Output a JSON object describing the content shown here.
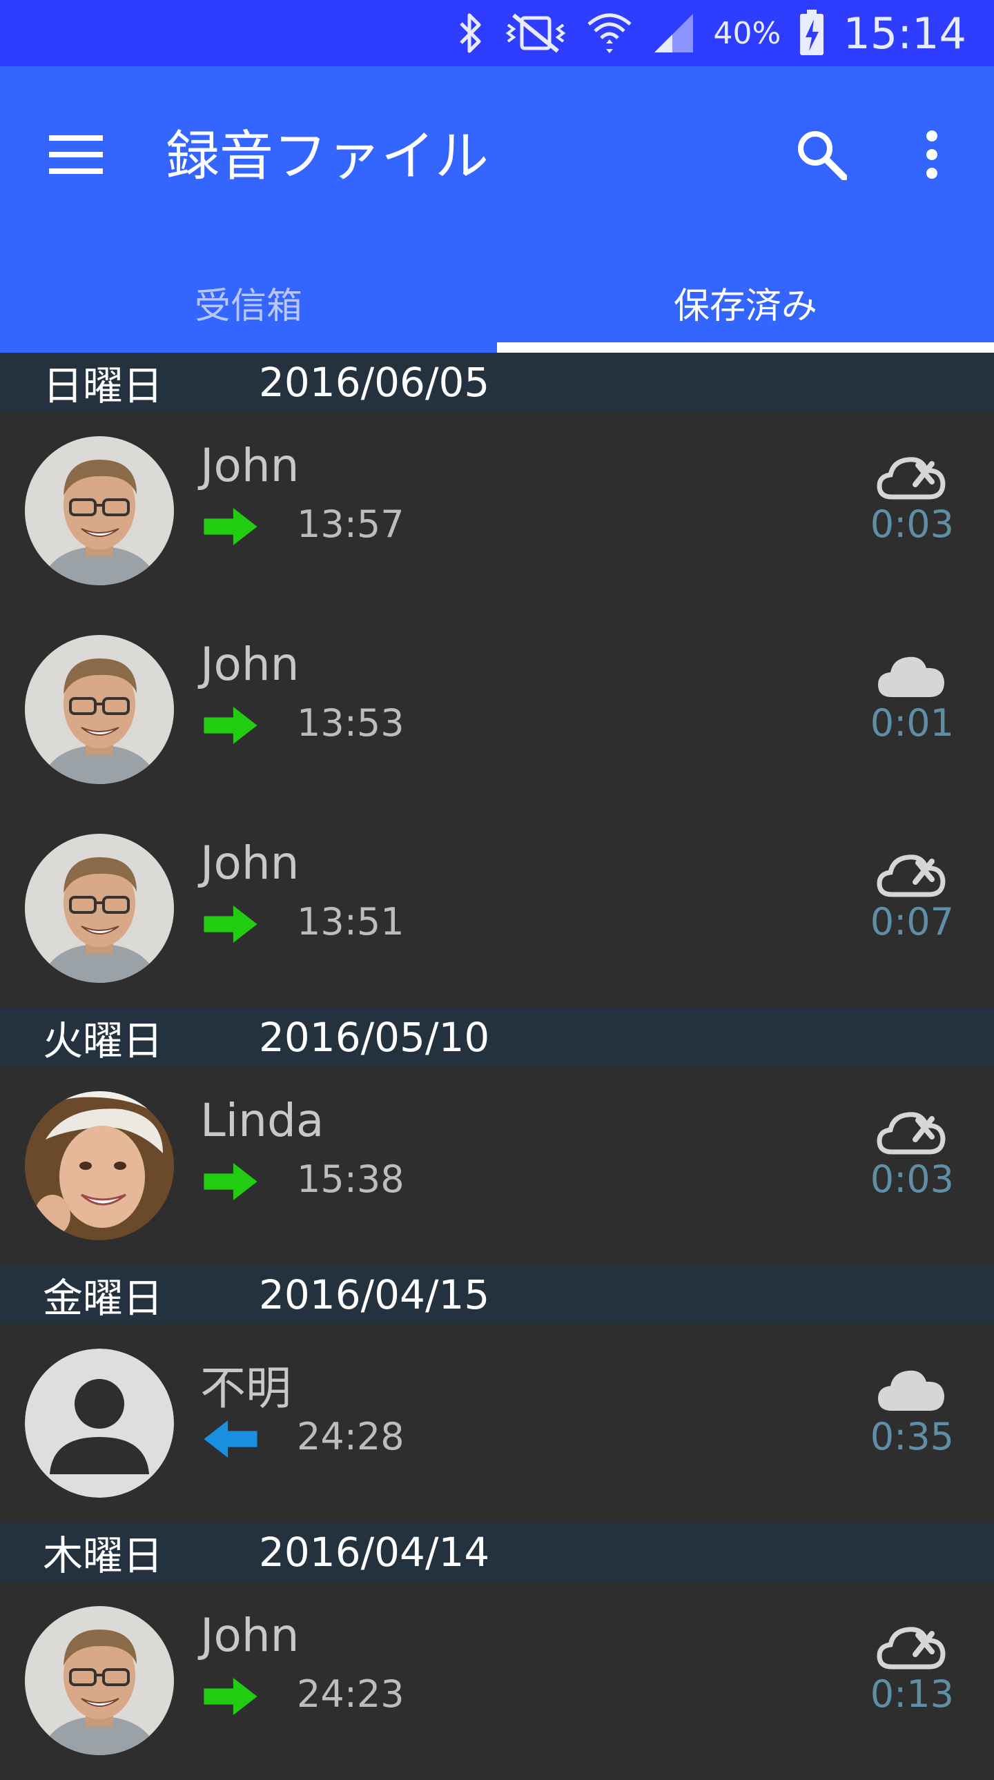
{
  "status_bar": {
    "battery_percent": "40%",
    "time": "15:14",
    "icons": [
      "bluetooth-icon",
      "vibrate-mute-icon",
      "wifi-icon",
      "signal-icon",
      "battery-charging-icon"
    ]
  },
  "app_bar": {
    "title": "録音ファイル",
    "menu_icon": "hamburger-menu-icon",
    "search_icon": "search-icon",
    "more_icon": "more-vert-icon"
  },
  "tabs": [
    {
      "label": "受信箱",
      "selected": false
    },
    {
      "label": "保存済み",
      "selected": true
    }
  ],
  "groups": [
    {
      "day": "日曜日",
      "date": "2016/06/05",
      "items": [
        {
          "name": "John",
          "direction": "outgoing",
          "time": "13:57",
          "duration": "0:03",
          "cloud": "cloud-off-icon"
        },
        {
          "name": "John",
          "direction": "outgoing",
          "time": "13:53",
          "duration": "0:01",
          "cloud": "cloud-icon"
        },
        {
          "name": "John",
          "direction": "outgoing",
          "time": "13:51",
          "duration": "0:07",
          "cloud": "cloud-off-icon"
        }
      ]
    },
    {
      "day": "火曜日",
      "date": "2016/05/10",
      "items": [
        {
          "name": "Linda",
          "direction": "outgoing",
          "time": "15:38",
          "duration": "0:03",
          "cloud": "cloud-off-icon"
        }
      ]
    },
    {
      "day": "金曜日",
      "date": "2016/04/15",
      "items": [
        {
          "name": "不明",
          "direction": "incoming",
          "time": "24:28",
          "duration": "0:35",
          "cloud": "cloud-icon"
        }
      ]
    },
    {
      "day": "木曜日",
      "date": "2016/04/14",
      "items": [
        {
          "name": "John",
          "direction": "outgoing",
          "time": "24:23",
          "duration": "0:13",
          "cloud": "cloud-off-icon"
        }
      ]
    }
  ],
  "colors": {
    "status_bar": "#2f3dff",
    "app_bar": "#3565ff",
    "date_header": "#243240",
    "row_background": "#2e2e2e",
    "outgoing_arrow": "#22cc11",
    "incoming_arrow": "#1a8fe0",
    "duration_text": "#5f8fa6"
  }
}
